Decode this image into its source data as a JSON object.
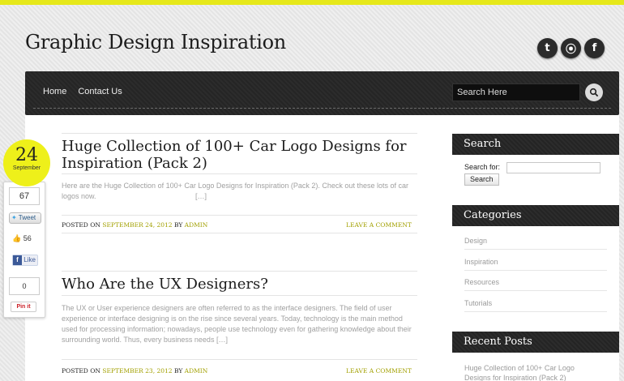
{
  "site": {
    "title": "Graphic Design Inspiration"
  },
  "social": {
    "icons": [
      {
        "name": "twitter-icon",
        "glyph": "t"
      },
      {
        "name": "rss-icon",
        "glyph": "⦿"
      },
      {
        "name": "facebook-icon",
        "glyph": "f"
      }
    ]
  },
  "nav": {
    "items": [
      "Home",
      "Contact Us"
    ],
    "search_placeholder": "Search Here"
  },
  "date_badge": {
    "day": "24",
    "month": "September"
  },
  "share": {
    "tweet_count": "67",
    "tweet_label": "Tweet",
    "like_count": "56",
    "like_label": "Like",
    "pin_count": "0",
    "pin_label": "Pin it"
  },
  "posts": [
    {
      "title": "Huge Collection of 100+ Car Logo Designs for Inspiration (Pack 2)",
      "excerpt": "Here are the Huge Collection of 100+ Car Logo Designs for Inspiration (Pack 2). Check out these lots of car logos now.",
      "more": "[…]",
      "posted_on_label": "POSTED ON",
      "date": "SEPTEMBER 24, 2012",
      "by_label": "BY",
      "author": "ADMIN",
      "comment_link": "LEAVE A COMMENT"
    },
    {
      "title": "Who Are the UX Designers?",
      "excerpt": "The UX or User experience designers are often referred to as the interface designers. The field of user experience or interface designing is on the rise since several years. Today, technology is the main method used for processing information; nowadays, people use technology even for gathering knowledge about their surrounding world. Thus, every business needs […]",
      "posted_on_label": "POSTED ON",
      "date": "SEPTEMBER 23, 2012",
      "by_label": "BY",
      "author": "ADMIN",
      "comment_link": "LEAVE A COMMENT"
    }
  ],
  "sidebar": {
    "search": {
      "title": "Search",
      "label": "Search for:",
      "button": "Search"
    },
    "categories": {
      "title": "Categories",
      "items": [
        "Design",
        "Inspiration",
        "Resources",
        "Tutorials"
      ]
    },
    "recent": {
      "title": "Recent Posts",
      "items": [
        "Huge Collection of 100+ Car Logo Designs for Inspiration (Pack 2)"
      ]
    }
  },
  "colors": {
    "accent": "#e6e81a",
    "link": "#a2a000",
    "dark": "#2a2a2a"
  }
}
